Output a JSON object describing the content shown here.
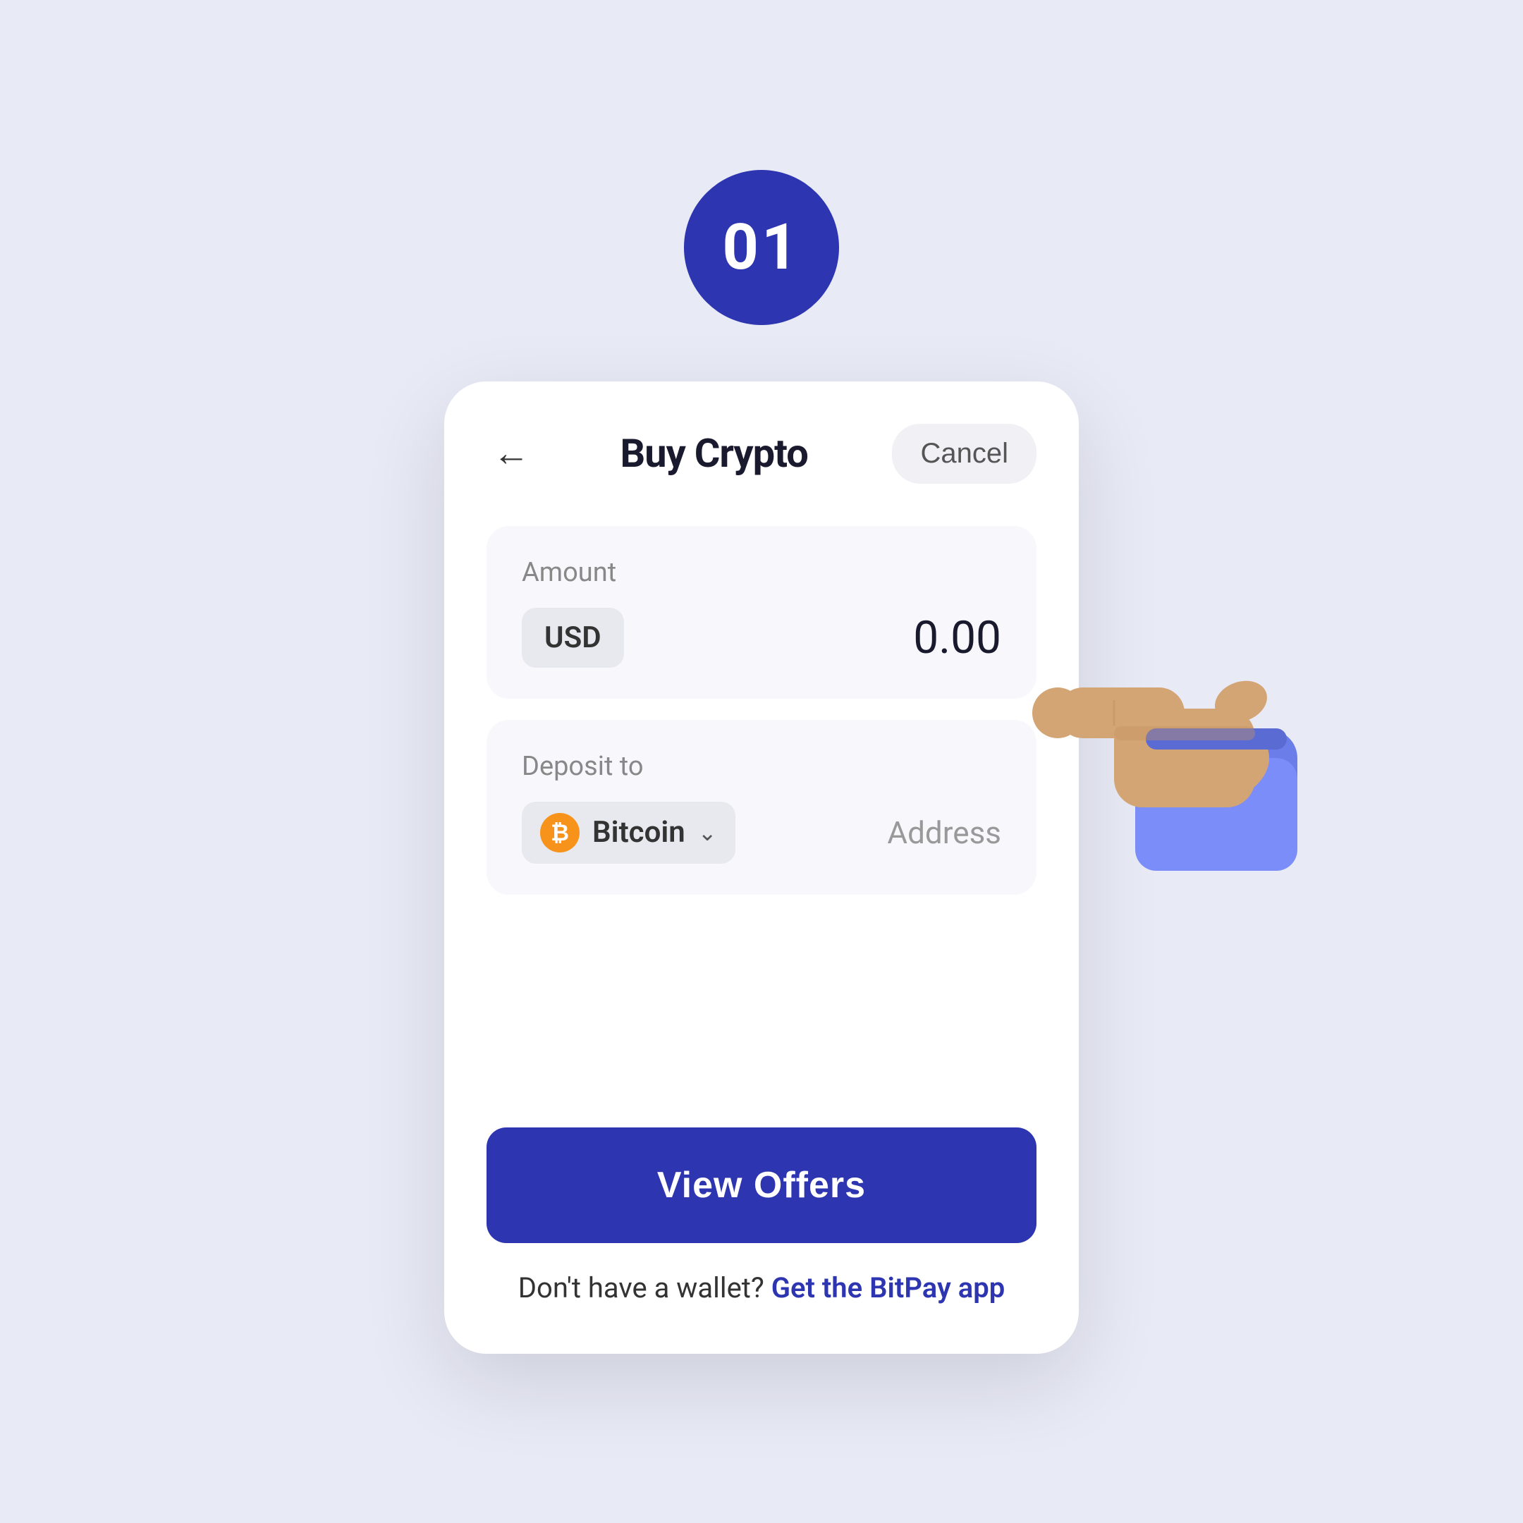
{
  "page": {
    "background_color": "#e8eaf6",
    "step_number": "01",
    "step_badge_color": "#2d35b0"
  },
  "header": {
    "title": "Buy Crypto",
    "back_label": "←",
    "cancel_label": "Cancel"
  },
  "amount_section": {
    "label": "Amount",
    "currency": "USD",
    "value": "0.00"
  },
  "deposit_section": {
    "label": "Deposit to",
    "crypto_name": "Bitcoin",
    "address_placeholder": "Address",
    "bitcoin_symbol": "₿"
  },
  "footer": {
    "view_offers_label": "View Offers",
    "wallet_prompt": "Don't have a wallet?",
    "wallet_link": "Get the BitPay app"
  }
}
